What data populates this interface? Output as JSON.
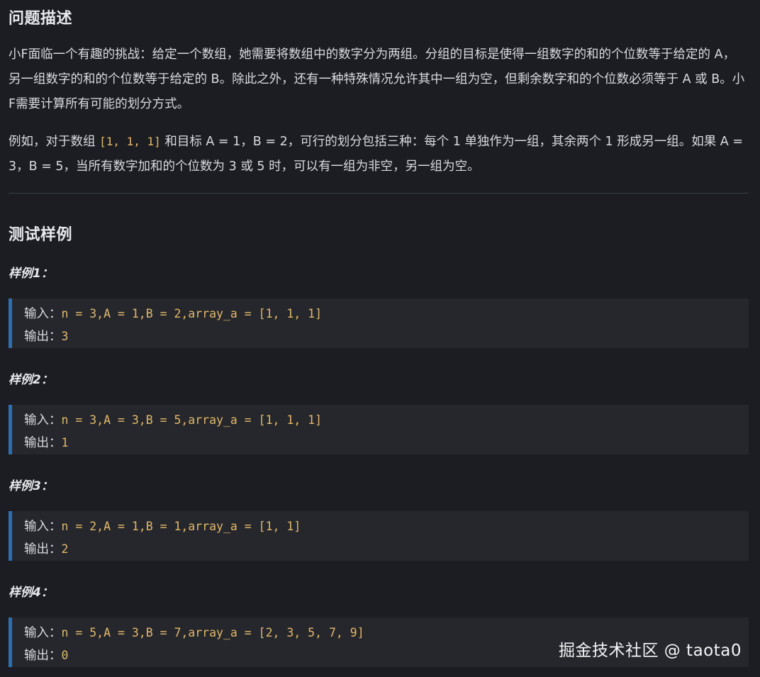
{
  "problem": {
    "heading": "问题描述",
    "para1": "小F面临一个有趣的挑战：给定一个数组，她需要将数组中的数字分为两组。分组的目标是使得一组数字的和的个位数等于给定的 A，另一组数字的和的个位数等于给定的 B。除此之外，还有一种特殊情况允许其中一组为空，但剩余数字和的个位数必须等于 A 或 B。小F需要计算所有可能的划分方式。",
    "para2_before": "例如，对于数组 ",
    "para2_code": "[1, 1, 1]",
    "para2_after": " 和目标 A = 1，B = 2，可行的划分包括三种：每个 1 单独作为一组，其余两个 1 形成另一组。如果 A = 3，B = 5，当所有数字加和的个位数为 3 或 5 时，可以有一组为非空，另一组为空。"
  },
  "tests": {
    "heading": "测试样例",
    "input_label": "输入：",
    "output_label": "输出：",
    "samples": [
      {
        "label": "样例1：",
        "input": "n = 3,A = 1,B = 2,array_a = [1, 1, 1]",
        "output": "3"
      },
      {
        "label": "样例2：",
        "input": "n = 3,A = 3,B = 5,array_a = [1, 1, 1]",
        "output": "1"
      },
      {
        "label": "样例3：",
        "input": "n = 2,A = 1,B = 1,array_a = [1, 1]",
        "output": "2"
      },
      {
        "label": "样例4：",
        "input": "n = 5,A = 3,B = 7,array_a = [2, 3, 5, 7, 9]",
        "output": "0"
      }
    ]
  },
  "watermark": "掘金技术社区 @ taota0"
}
